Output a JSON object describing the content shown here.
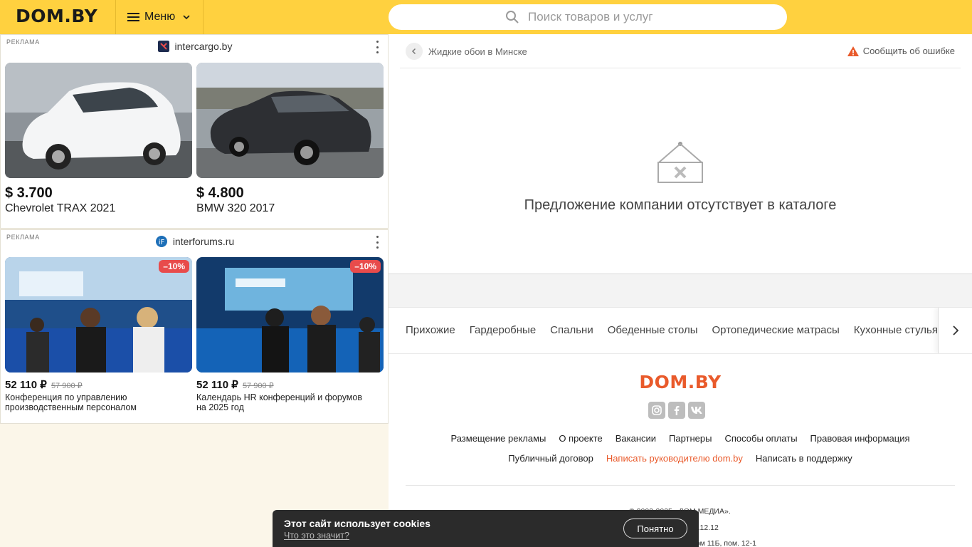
{
  "header": {
    "logo": "DOM.BY",
    "menu_label": "Меню",
    "search_placeholder": "Поиск товаров и услуг"
  },
  "ads": [
    {
      "label": "РЕКЛАМА",
      "source": "intercargo.by",
      "items": [
        {
          "price": "$ 3.700",
          "title": "Chevrolet TRAX 2021"
        },
        {
          "price": "$ 4.800",
          "title": "BMW 320 2017"
        }
      ]
    },
    {
      "label": "РЕКЛАМА",
      "source": "interforums.ru",
      "items": [
        {
          "badge": "–10%",
          "price": "52 110 ₽",
          "old_price": "57 900 ₽",
          "title_line1": "Конференция по управлению",
          "title_line2": "производственным персоналом"
        },
        {
          "badge": "–10%",
          "price": "52 110 ₽",
          "old_price": "57 900 ₽",
          "title_line1": "Календарь HR конференций и форумов",
          "title_line2": "на 2025 год"
        }
      ]
    }
  ],
  "main": {
    "breadcrumb": "Жидкие обои в Минске",
    "report_label": "Сообщить об ошибке",
    "empty_message": "Предложение компании отсутствует в каталоге"
  },
  "categories": [
    "Прихожие",
    "Гардеробные",
    "Спальни",
    "Обеденные столы",
    "Ортопедические матрасы",
    "Кухонные стулья"
  ],
  "footer": {
    "logo": "DOM.BY",
    "links_row1": [
      "Размещение рекламы",
      "О проекте",
      "Вакансии",
      "Партнеры",
      "Способы оплаты",
      "Правовая информация"
    ],
    "links_row2": [
      "Публичный договор",
      "Написать руководителю dom.by",
      "Написать в поддержку"
    ],
    "copyright_line1": "© 2002-2025 «ДОМ МЕДИА».",
    "copyright_line2": "Мингорисполком 10.12.12",
    "copyright_line3": "ул. Центральная, дом 11Б, пом. 12-1"
  },
  "cookie": {
    "title": "Этот сайт использует cookies",
    "link": "Что это значит?",
    "button": "Понятно"
  },
  "colors": {
    "header_bg": "#ffd13f",
    "accent": "#e95a2b",
    "badge": "#e84b4b"
  }
}
